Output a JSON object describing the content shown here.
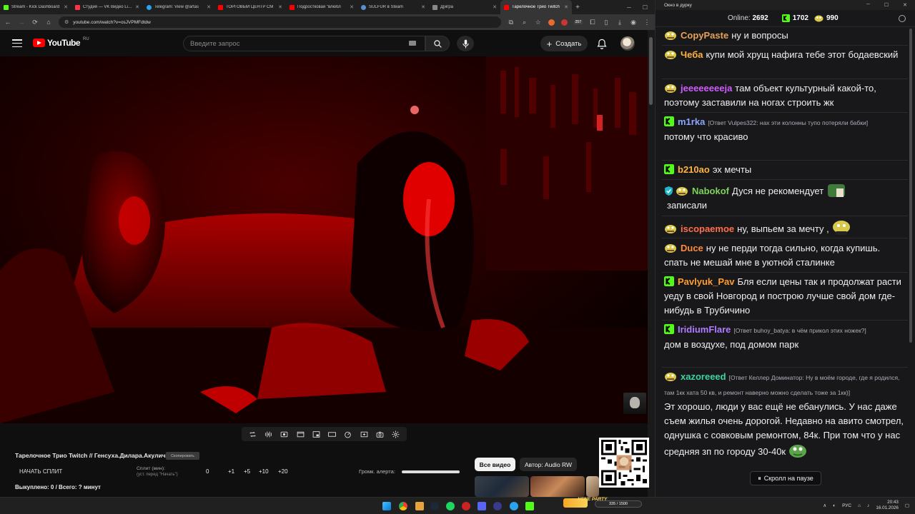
{
  "browser": {
    "tabs": [
      {
        "label": "Stream - Kick Dashboard",
        "color": "#53fc18"
      },
      {
        "label": "Студия — VK Видео Live",
        "color": "#ff3347"
      },
      {
        "label": "Telegram: View @artas",
        "color": "#2aa3ef"
      },
      {
        "label": "ТОРГОВЫЙ ЦЕНТР СМ",
        "color": "#ff0000"
      },
      {
        "label": "Подростковая \"влюбл",
        "color": "#ff0000"
      },
      {
        "label": "SULFUR в Steam",
        "color": "#1b2838"
      },
      {
        "label": "Д[игра",
        "color": "#888888"
      },
      {
        "label": "Тарелочное Трио Twitch",
        "color": "#ff0000",
        "active": true
      }
    ],
    "url": "youtube.com/watch?v=osJVPMFdtdw",
    "badge_count": "257"
  },
  "youtube": {
    "logo_text": "YouTube",
    "region": "RU",
    "search_placeholder": "Введите запрос",
    "create_label": "Создать"
  },
  "panel": {
    "stream_title": "Тарелочное Трио Twitch // Генсуха.Дилара.Акулич",
    "copy_badge": "Скопировать",
    "start_split": "НАЧАТЬ СПЛИТ",
    "split_label": "Сплит (мин):",
    "split_sub": "(уст. перед \"Начать\")",
    "split_value": "0",
    "increments": [
      "+1",
      "+5",
      "+10",
      "+20"
    ],
    "redeemed": "Выкуплено: 0 / Всего: ? минут",
    "alert_label": "Громк. алерта:",
    "alert_volume": 1.0,
    "all_videos": "Все видео",
    "author": "Автор: Audio RW",
    "party_text": "NENE PARTY",
    "party_counter": "335 / 1500"
  },
  "taskbar": {
    "lang": "РУС",
    "time": "20:43",
    "date": "16.01.2026"
  },
  "chat": {
    "window_title": "Окно в дурку",
    "online_label": "Online:",
    "online_count": "2692",
    "kick_count": "1702",
    "points_count": "990",
    "pause_label": "Скролл на паузе",
    "messages": [
      {
        "user": "CopyPaste",
        "color": "#f1a24d",
        "badge": "pepe",
        "text": "ну и вопросы"
      },
      {
        "user": "Чеба",
        "color": "#ffb340",
        "badge": "pepe",
        "text": "купи мой хрущ нафига тебе этот бодаевский"
      },
      {
        "user": "jeeeeeeeeja",
        "color": "#d05cff",
        "badge": "pepe",
        "text": "там объект культурный какой-то, поэтому заставили на ногах строить жк"
      },
      {
        "user": "m1rka",
        "color": "#8aa7ff",
        "badge": "kick",
        "reply": "[Ответ Vulpes322: нах эти колонны тупо потеряли бабки]",
        "text": "потому что красиво"
      },
      {
        "user": "b210ao",
        "color": "#ffb340",
        "badge": "kick",
        "text": "эх мечты"
      },
      {
        "user": "Nabokof",
        "color": "#7fd35a",
        "badge": "verified",
        "text": "Дуся не рекомендует",
        "text2": "записали"
      },
      {
        "user": "iscopaemoe",
        "color": "#ff6f4d",
        "badge": "pepe",
        "text": "ну, выпьем за мечту ,"
      },
      {
        "user": "Duce",
        "color": "#ff8a3c",
        "badge": "pepe",
        "text": "ну не перди тогда сильно, когда купишь. спать не мешай мне в уютной сталинке"
      },
      {
        "user": "Pavlyuk_Pav",
        "color": "#ff9d2e",
        "badge": "kick",
        "text": "Бля если цены так и продолжат расти уеду в свой Новгород и построю лучше свой дом где-нибудь в Трубичино"
      },
      {
        "user": "IridiumFlare",
        "color": "#b07cff",
        "badge": "kick",
        "reply": "[Ответ buhoy_batya: в чём прикол этих ножек?]",
        "text": "дом в воздухе, под домом парк"
      },
      {
        "user": "xazoreeed",
        "color": "#3bd6a0",
        "badge": "pepe",
        "reply": "[Ответ Келлер Доминатор: Ну в моём городе, где я родился, там 1кк хата 50 кв, и ремонт наверно можно сделать тоже за 1кк)]",
        "text": "Эт хорошо, люди у вас ещё не ебанулись. У нас даже съем жилья очень дорогой. Недавно на авито смотрел, однушка с совковым ремонтом, 84к. При том что у нас средняя зп по городу 30-40к"
      }
    ]
  }
}
